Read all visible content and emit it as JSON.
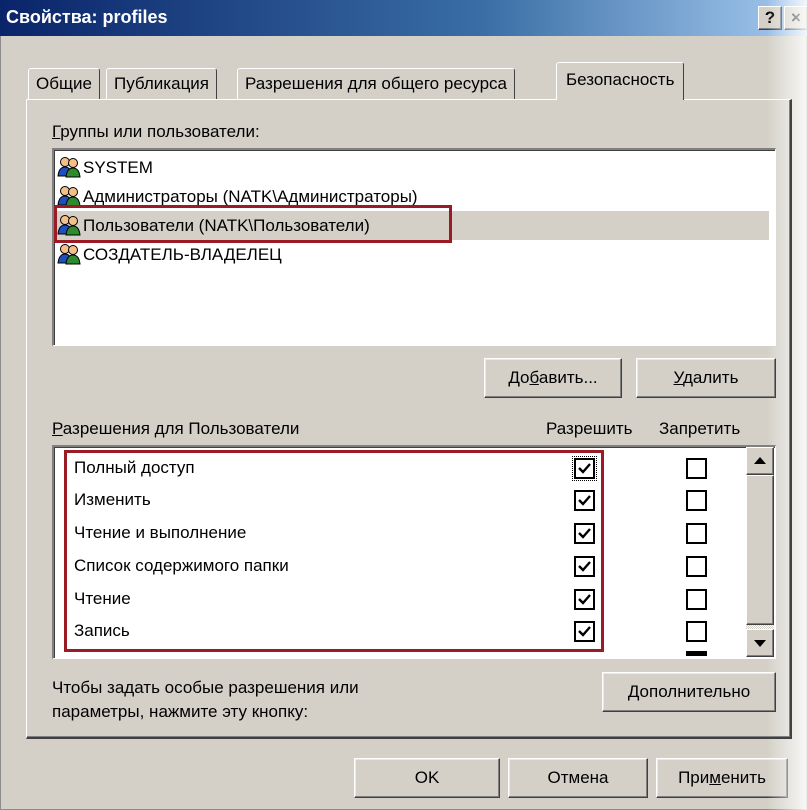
{
  "window": {
    "title": "Свойства: profiles",
    "help_label": "?",
    "close_label": "×"
  },
  "tabs": [
    {
      "label": "Общие",
      "active": false
    },
    {
      "label": "Публикация",
      "active": false
    },
    {
      "label": "Разрешения для общего ресурса",
      "active": false
    },
    {
      "label": "Безопасность",
      "active": true
    }
  ],
  "groups": {
    "label_u": "Г",
    "label_rest": "руппы или пользователи:",
    "items": [
      {
        "label": "SYSTEM",
        "icon": "user-group-icon",
        "selected": false
      },
      {
        "label": "Администраторы (NATK\\Администраторы)",
        "icon": "user-group-icon",
        "selected": false
      },
      {
        "label": "Пользователи (NATK\\Пользователи)",
        "icon": "user-group-icon",
        "selected": true
      },
      {
        "label": "СОЗДАТЕЛЬ-ВЛАДЕЛЕЦ",
        "icon": "user-group-icon",
        "selected": false
      }
    ],
    "add_pre": "До",
    "add_u": "б",
    "add_post": "авить...",
    "remove_u": "У",
    "remove_post": "далить"
  },
  "permissions": {
    "label_u": "Р",
    "label_rest": "азрешения для Пользователи",
    "allow_header": "Разрешить",
    "deny_header": "Запретить",
    "rows": [
      {
        "label": "Полный доступ",
        "allow": true,
        "deny": false
      },
      {
        "label": "Изменить",
        "allow": true,
        "deny": false
      },
      {
        "label": "Чтение и выполнение",
        "allow": true,
        "deny": false
      },
      {
        "label": "Список содержимого папки",
        "allow": true,
        "deny": false
      },
      {
        "label": "Чтение",
        "allow": true,
        "deny": false
      },
      {
        "label": "Запись",
        "allow": true,
        "deny": false
      }
    ]
  },
  "advanced": {
    "hint_line1": "Чтобы задать особые разрешения или",
    "hint_line2": "параметры, нажмите эту кнопку:",
    "button_u": "Д",
    "button_post": "ополнительно"
  },
  "footer": {
    "ok_label": "OK",
    "cancel_label": "Отмена",
    "apply_pre": "При",
    "apply_u": "м",
    "apply_post": "енить"
  },
  "colors": {
    "highlight": "#9b1b25",
    "titlebar_start": "#0a246a",
    "titlebar_end": "#a6caf0",
    "face": "#d4d0c8"
  }
}
